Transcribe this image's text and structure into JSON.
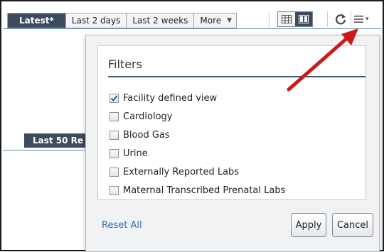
{
  "toolbar": {
    "tabs": [
      {
        "label": "Latest*",
        "active": true
      },
      {
        "label": "Last 2 days",
        "active": false
      },
      {
        "label": "Last 2 weeks",
        "active": false
      }
    ],
    "more_label": "More",
    "view_buttons": [
      {
        "icon": "table-grid-icon",
        "selected": false
      },
      {
        "icon": "split-view-icon",
        "selected": true
      }
    ],
    "refresh_icon": "refresh-icon",
    "menu_icon": "hamburger-menu-icon"
  },
  "background": {
    "section_label": "Last 50 Re"
  },
  "filters": {
    "title": "Filters",
    "options": [
      {
        "label": "Facility defined view",
        "checked": true
      },
      {
        "label": "Cardiology",
        "checked": false
      },
      {
        "label": "Blood Gas",
        "checked": false
      },
      {
        "label": "Urine",
        "checked": false
      },
      {
        "label": "Externally Reported Labs",
        "checked": false
      },
      {
        "label": "Maternal Transcribed Prenatal Labs",
        "checked": false
      }
    ],
    "reset_label": "Reset All",
    "apply_label": "Apply",
    "cancel_label": "Cancel"
  },
  "annotation": {
    "arrow_color": "#cc1a1a"
  },
  "colors": {
    "active_tab": "#3d4b5c",
    "link": "#2e6fb0",
    "rule": "#3d5a73"
  }
}
